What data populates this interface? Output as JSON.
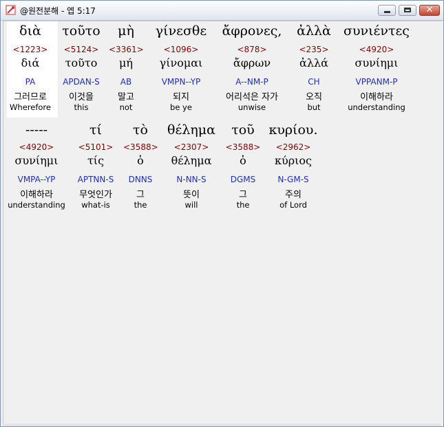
{
  "window": {
    "title": "@원전분해 - 엡 5:17"
  },
  "controls": {
    "close_glyph": "✕"
  },
  "rows": [
    {
      "words": [
        {
          "greek": "διὰ",
          "strong": "<1223>",
          "lemma": "διά",
          "parse": "PA",
          "korean": "그러므로",
          "english": "Wherefore"
        },
        {
          "greek": "τοῦτο",
          "strong": "<5124>",
          "lemma": "τοῦτο",
          "parse": "APDAN-S",
          "korean": "이것을",
          "english": "this"
        },
        {
          "greek": "μὴ",
          "strong": "<3361>",
          "lemma": "μή",
          "parse": "AB",
          "korean": "말고",
          "english": "not"
        },
        {
          "greek": "γίνεσθε",
          "strong": "<1096>",
          "lemma": "γίνομαι",
          "parse": "VMPN--YP",
          "korean": "되지",
          "english": "be ye"
        },
        {
          "greek": "ἄφρονες,",
          "strong": "<878>",
          "lemma": "ἄφρων",
          "parse": "A--NM-P",
          "korean": "어리석은 자가",
          "english": "unwise"
        },
        {
          "greek": "ἀλλὰ",
          "strong": "<235>",
          "lemma": "ἀλλά",
          "parse": "CH",
          "korean": "오직",
          "english": "but"
        },
        {
          "greek": "συνιέντες",
          "strong": "<4920>",
          "lemma": "συνίημι",
          "parse": "VPPANM-P",
          "korean": "이해하라",
          "english": "understanding"
        }
      ]
    },
    {
      "words": [
        {
          "greek": "-----",
          "strong": "<4920>",
          "lemma": "συνίημι",
          "parse": "VMPA--YP",
          "korean": "이해하라",
          "english": "understanding"
        },
        {
          "greek": "τί",
          "strong": "<5101>",
          "lemma": "τίς",
          "parse": "APTNN-S",
          "korean": "무엇인가",
          "english": "what-is"
        },
        {
          "greek": "τὸ",
          "strong": "<3588>",
          "lemma": "ὁ",
          "parse": "DNNS",
          "korean": "그",
          "english": "the"
        },
        {
          "greek": "θέλημα",
          "strong": "<2307>",
          "lemma": "θέλημα",
          "parse": "N-NN-S",
          "korean": "뜻이",
          "english": "will"
        },
        {
          "greek": "τοῦ",
          "strong": "<3588>",
          "lemma": "ὁ",
          "parse": "DGMS",
          "korean": "그",
          "english": "the"
        },
        {
          "greek": "κυρίου.",
          "strong": "<2962>",
          "lemma": "κύριος",
          "parse": "N-GM-S",
          "korean": "주의",
          "english": "of Lord"
        }
      ]
    }
  ]
}
